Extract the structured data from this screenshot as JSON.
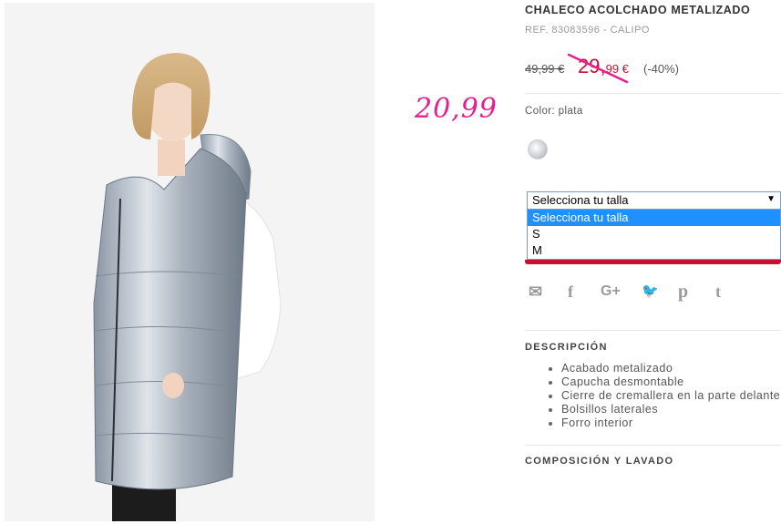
{
  "product": {
    "title": "CHALECO ACOLCHADO METALIZADO",
    "ref": "REF. 83083596 - CALIPO",
    "old_price": "49,99 €",
    "sale_price_int": "29,",
    "sale_price_dec": "99 €",
    "discount": "(-40%)",
    "handwritten_price": "20,99",
    "color_label": "Color: plata",
    "color_swatch": "silver-swatch"
  },
  "size_select": {
    "value": "Selecciona tu talla",
    "options": [
      "Selecciona tu talla",
      "S",
      "M"
    ],
    "selected_index": 0
  },
  "share": {
    "icons": [
      "mail-icon",
      "facebook-icon",
      "google-plus-icon",
      "twitter-icon",
      "pinterest-icon",
      "tumblr-icon"
    ],
    "glyphs": [
      "✉",
      "f",
      "G+",
      "🐦",
      "p",
      "t"
    ]
  },
  "description": {
    "heading": "DESCRIPCIÓN",
    "items": [
      "Acabado metalizado",
      "Capucha desmontable",
      "Cierre de cremallera en la parte delantera",
      "Bolsillos laterales",
      "Forro interior"
    ]
  },
  "composition": {
    "heading": "COMPOSICIÓN Y LAVADO"
  },
  "colors": {
    "accent": "#c8102e",
    "handwriting": "#e91e8c",
    "select_highlight": "#1e90ff"
  }
}
